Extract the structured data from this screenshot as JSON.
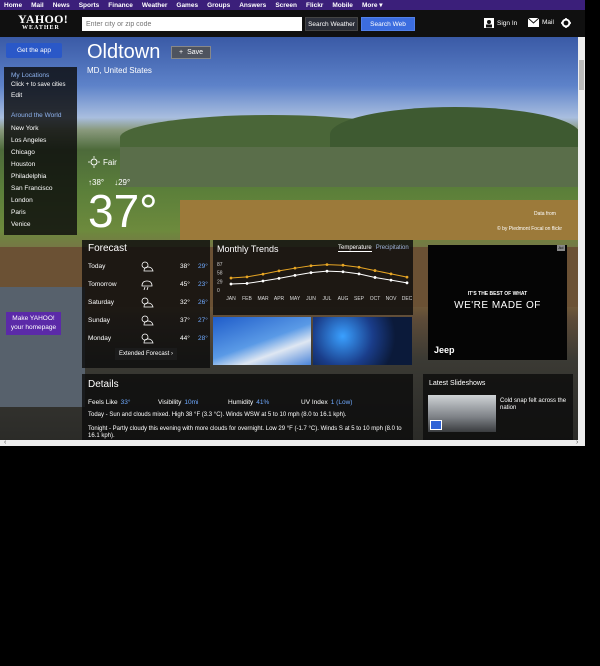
{
  "topnav": {
    "items": [
      "Home",
      "Mail",
      "News",
      "Sports",
      "Finance",
      "Weather",
      "Games",
      "Groups",
      "Answers",
      "Screen",
      "Flickr",
      "Mobile",
      "More ▾"
    ]
  },
  "header": {
    "logo_main": "YAHOO!",
    "logo_sub": "WEATHER",
    "search_placeholder": "Enter city or zip code",
    "search_weather_label": "Search Weather",
    "search_web_label": "Search Web",
    "signin_label": "Sign In",
    "mail_label": "Mail"
  },
  "sidebar": {
    "get_app_label": "Get the app",
    "my_locations_title": "My Locations",
    "click_to_save": "Click + to save cities",
    "edit_label": "Edit",
    "around_world_title": "Around the World",
    "cities": [
      "New York",
      "Los Angeles",
      "Chicago",
      "Houston",
      "Philadelphia",
      "San Francisco",
      "London",
      "Paris",
      "Venice"
    ],
    "make_yahoo_line1": "Make YAHOO!",
    "make_yahoo_line2": "your homepage"
  },
  "location": {
    "city": "Oldtown",
    "region": "MD, United States",
    "save_label": "Save",
    "save_icon": "+"
  },
  "current": {
    "condition": "Fair",
    "high": "38°",
    "low": "29°",
    "temp": "37°"
  },
  "photo": {
    "credit": "© by Piedmont Focal on flickr",
    "data_from": "Data from"
  },
  "forecast": {
    "title": "Forecast",
    "days": [
      {
        "day": "Today",
        "high": "38°",
        "low": "29°"
      },
      {
        "day": "Tomorrow",
        "high": "45°",
        "low": "23°"
      },
      {
        "day": "Saturday",
        "high": "32°",
        "low": "26°"
      },
      {
        "day": "Sunday",
        "high": "37°",
        "low": "27°"
      },
      {
        "day": "Monday",
        "high": "44°",
        "low": "28°"
      }
    ],
    "extended_label": "Extended Forecast ›"
  },
  "trends": {
    "title": "Monthly Trends",
    "tab_temperature": "Temperature",
    "tab_precipitation": "Precipitation",
    "y_ticks": [
      "87",
      "58",
      "29",
      "0"
    ]
  },
  "chart_data": {
    "type": "line",
    "categories": [
      "JAN",
      "FEB",
      "MAR",
      "APR",
      "MAY",
      "JUN",
      "JUL",
      "AUG",
      "SEP",
      "OCT",
      "NOV",
      "DEC"
    ],
    "series": [
      {
        "values": [
          40,
          44,
          53,
          64,
          73,
          81,
          85,
          83,
          76,
          65,
          54,
          43
        ],
        "color": "#e8a624"
      },
      {
        "values": [
          20,
          22,
          30,
          39,
          49,
          58,
          63,
          61,
          54,
          42,
          33,
          24
        ],
        "color": "#ffffff"
      }
    ],
    "ylim": [
      0,
      87
    ]
  },
  "ad": {
    "line1": "IT'S THE BEST OF WHAT",
    "line2": "WE'RE MADE OF",
    "brand": "Jeep",
    "ad_tag": "Ad"
  },
  "details": {
    "title": "Details",
    "feels_like_label": "Feels Like",
    "feels_like_value": "33°",
    "visibility_label": "Visibility",
    "visibility_value": "10mi",
    "humidity_label": "Humidity",
    "humidity_value": "41%",
    "uv_label": "UV Index",
    "uv_value": "1 (Low)",
    "today_text": "Today - Sun and clouds mixed. High 38 °F (3.3 °C). Winds WSW at 5 to 10 mph (8.0 to 16.1 kph).",
    "tonight_text": "Tonight - Partly cloudy this evening with more clouds for overnight. Low 29 °F (-1.7 °C). Winds S at 5 to 10 mph (8.0 to 16.1 kph)."
  },
  "slideshows": {
    "title": "Latest Slideshows",
    "item_text": "Cold snap felt across the nation"
  }
}
